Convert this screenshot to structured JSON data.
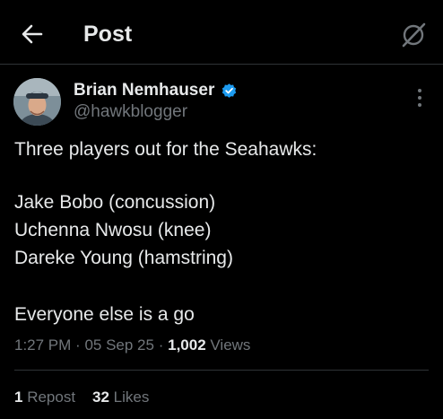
{
  "header": {
    "title": "Post",
    "back_icon": "arrow-left-icon",
    "grok_icon": "grok-icon"
  },
  "author": {
    "name": "Brian Nemhauser",
    "handle": "@hawkblogger",
    "verified": true,
    "verified_color": "#1d9bf0"
  },
  "post": {
    "lines": [
      "Three players out for the Seahawks:",
      "",
      "Jake Bobo (concussion)",
      "Uchenna Nwosu (knee)",
      "Dareke Young (hamstring)",
      "",
      "Everyone else is a go"
    ],
    "time": "1:27 PM",
    "separator": "·",
    "date": "05 Sep 25",
    "views_count": "1,002",
    "views_label": "Views"
  },
  "stats": {
    "reposts_count": "1",
    "reposts_label": "Repost",
    "likes_count": "32",
    "likes_label": "Likes"
  },
  "colors": {
    "background": "#000000",
    "text_primary": "#e7e9ea",
    "text_secondary": "#71767b",
    "divider": "#2f3336"
  }
}
